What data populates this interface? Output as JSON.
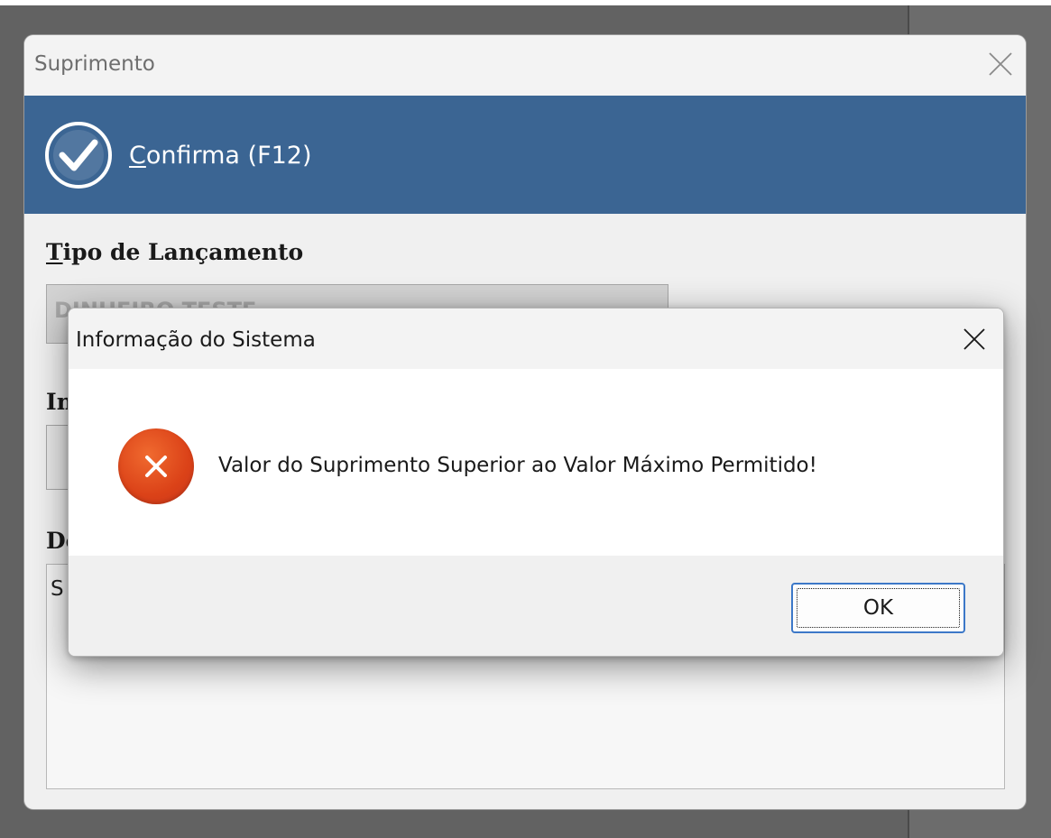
{
  "main_window": {
    "title": "Suprimento",
    "toolbar": {
      "confirm_prefix": "C",
      "confirm_rest": "onfirma (F12)"
    },
    "fields": {
      "tipo_label_prefix": "T",
      "tipo_label_rest": "ipo de Lançamento",
      "tipo_value": "DINHEIRO TESTE",
      "second_label": "In",
      "desc_label": "De",
      "desc_value": "S"
    }
  },
  "message_box": {
    "title": "Informação do Sistema",
    "message": "Valor do Suprimento Superior ao Valor Máximo Permitido!",
    "ok_label": "OK",
    "icon": "error-icon"
  },
  "colors": {
    "toolbar": "#3b6593",
    "error_icon": "#db4218",
    "ok_border": "#3c78c8"
  }
}
